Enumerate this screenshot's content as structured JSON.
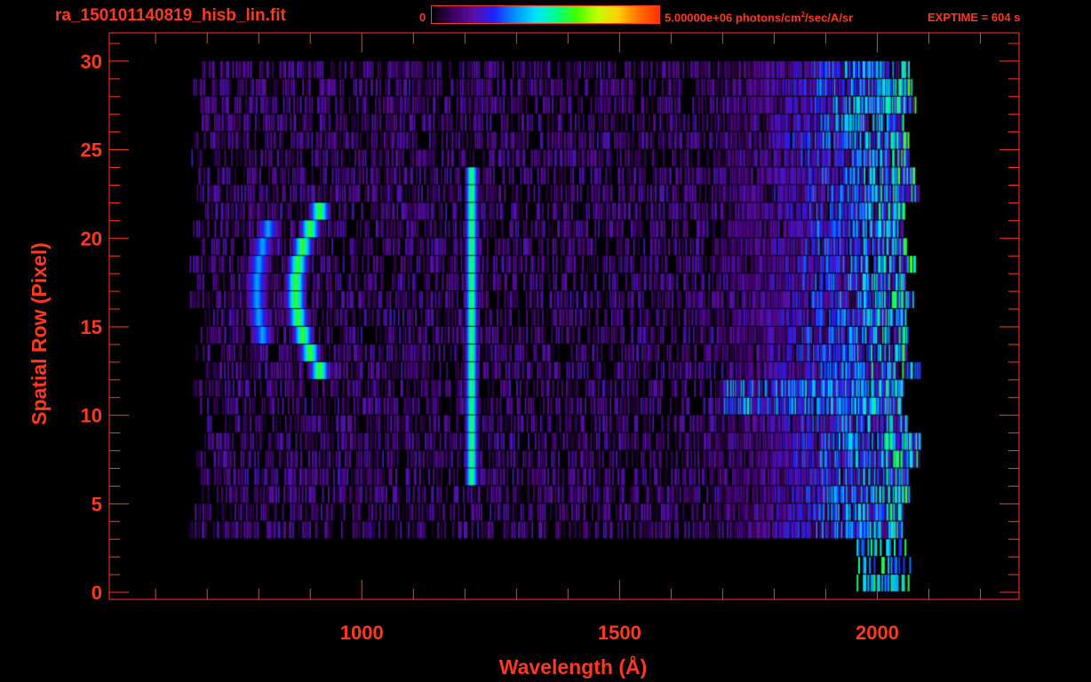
{
  "header": {
    "file_title": "ra_150101140819_hisb_lin.fit",
    "colorbar_min": "0",
    "colorbar_max_prefix": "5.00000e+06 photons/cm",
    "colorbar_max_sup": "2",
    "colorbar_max_suffix": "/sec/A/sr",
    "exptime": "EXPTIME = 604 s"
  },
  "colors": {
    "axis": "#ff3a1f",
    "background": "#000000",
    "colormap": [
      "#000000",
      "#3a0060",
      "#5a10a0",
      "#2020ff",
      "#0090ff",
      "#00e0ff",
      "#00ff90",
      "#40ff00",
      "#c0ff00",
      "#ffd000",
      "#ff7000",
      "#ff3000"
    ]
  },
  "chart_data": {
    "type": "heatmap",
    "xlabel": "Wavelength (Å)",
    "ylabel": "Spatial Row (Pixel)",
    "xlim": [
      510,
      2275
    ],
    "ylim": [
      -0.4,
      31.6
    ],
    "xticks": [
      1000,
      1500,
      2000
    ],
    "xtick_labels": [
      "1000",
      "1500",
      "2000"
    ],
    "yticks": [
      0,
      5,
      10,
      15,
      20,
      25,
      30
    ],
    "ytick_labels": [
      "0",
      "5",
      "10",
      "15",
      "20",
      "25",
      "30"
    ],
    "colorbar_range": [
      0,
      5000000
    ],
    "rows": 30,
    "data_x_range": [
      680,
      2085
    ],
    "features": [
      {
        "kind": "arc",
        "x_center_at_row_17": 870,
        "rows": [
          12,
          22
        ],
        "curvature": 58,
        "peak": 0.55
      },
      {
        "kind": "arc",
        "x_center_at_row_17": 795,
        "rows": [
          14,
          21
        ],
        "curvature": 45,
        "peak": 0.3
      },
      {
        "kind": "vertical_line",
        "x": 1212,
        "rows": [
          6,
          24
        ],
        "peak": 0.55
      },
      {
        "kind": "band",
        "rows": [
          10,
          12
        ],
        "x_range": [
          1700,
          2060
        ],
        "peak": 0.5
      },
      {
        "kind": "gradient",
        "x_range": [
          1650,
          2075
        ],
        "peak": 0.6
      }
    ]
  }
}
